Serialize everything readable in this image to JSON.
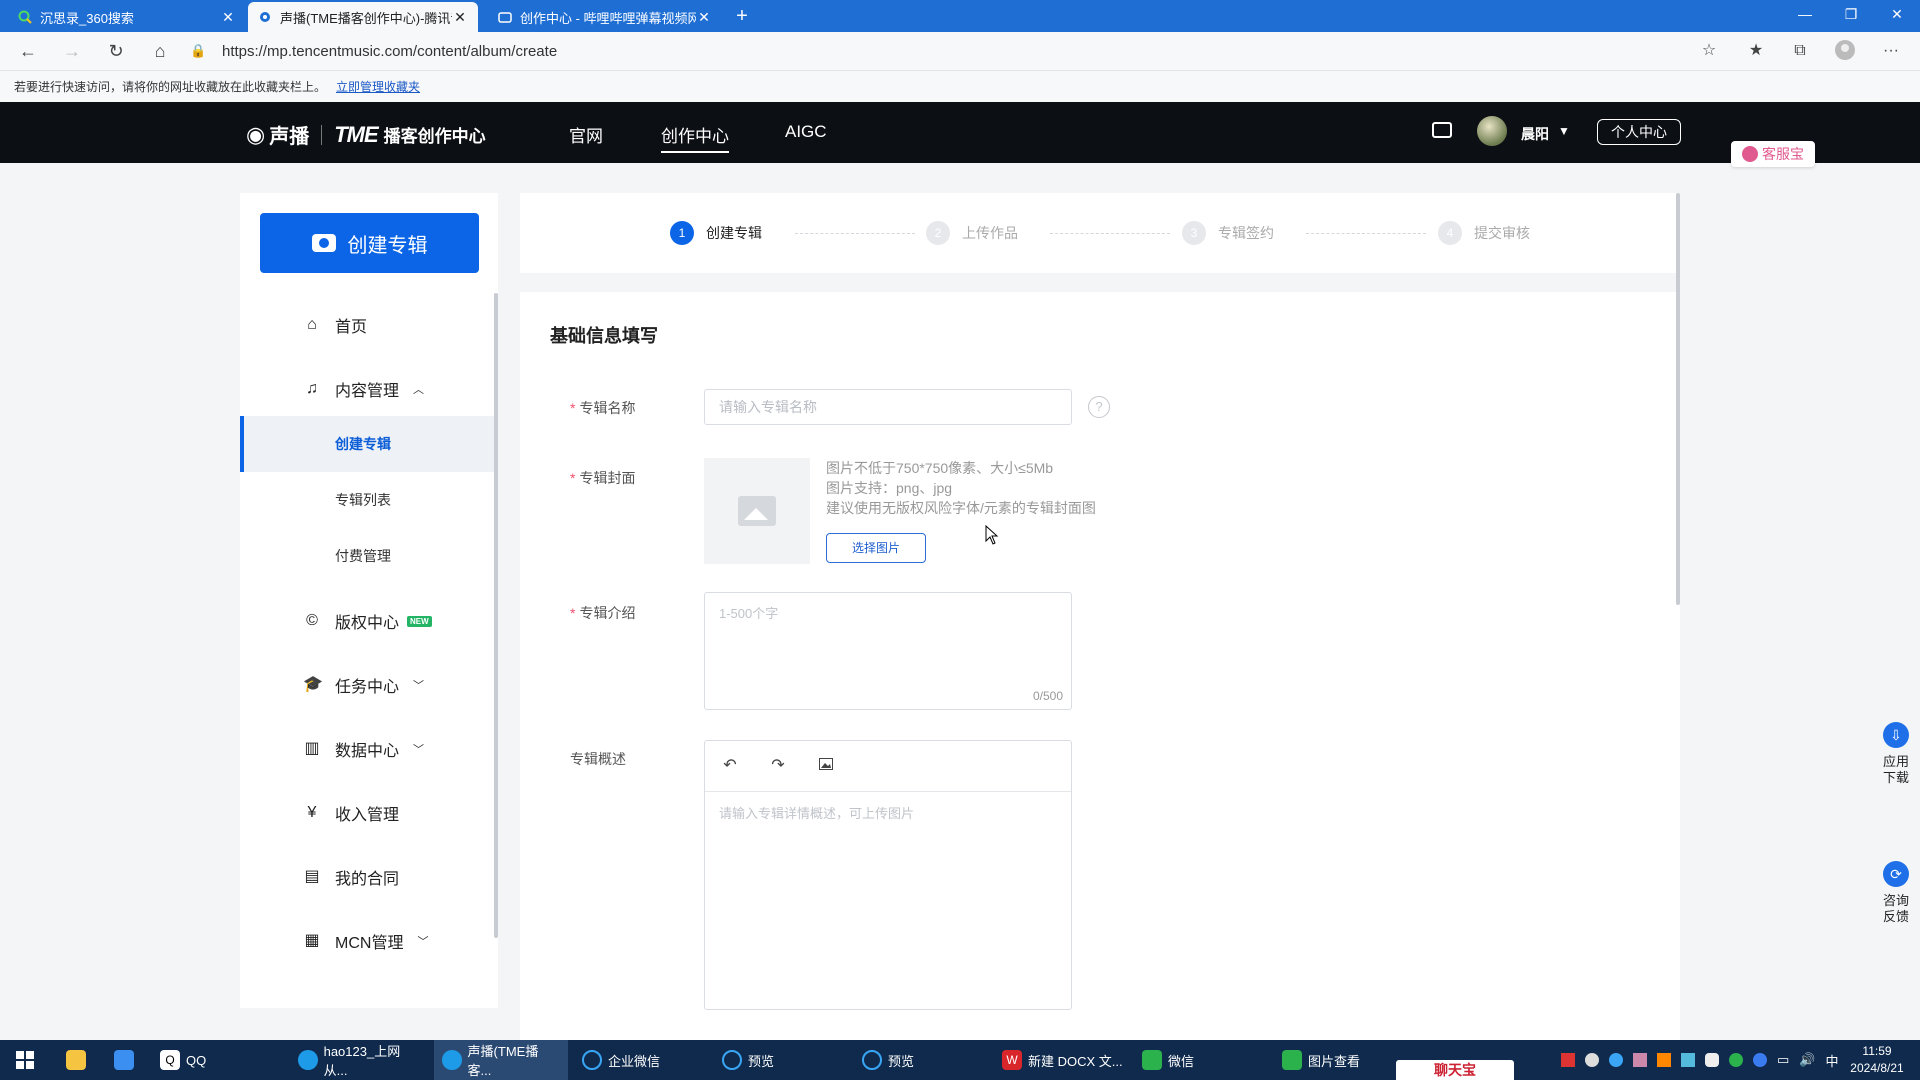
{
  "browser": {
    "tabs": [
      {
        "title": "沉思录_360搜索",
        "icon": "search-icon"
      },
      {
        "title": "声播(TME播客创作中心)-腾讯音",
        "icon": "site-icon"
      },
      {
        "title": "创作中心 - 哔哩哔哩弹幕视频网",
        "icon": "bilibili-icon"
      }
    ],
    "url": "https://mp.tencentmusic.com/content/album/create",
    "favbar_message": "若要进行快速访问，请将你的网址收藏放在此收藏夹栏上。",
    "favbar_link": "立即管理收藏夹"
  },
  "header": {
    "logo_name": "声播",
    "logo_brand": "TME",
    "logo_sub": "播客创作中心",
    "nav": [
      "官网",
      "创作中心",
      "AIGC"
    ],
    "active_nav": "创作中心",
    "user_name": "晨阳",
    "center_button": "个人中心",
    "kefu": "客服宝"
  },
  "sidebar": {
    "create_button": "创建专辑",
    "items": [
      {
        "label": "首页",
        "icon": "home-icon"
      },
      {
        "label": "内容管理",
        "icon": "music-folder-icon",
        "expanded": true
      },
      {
        "label": "版权中心",
        "icon": "copyright-icon",
        "badge": "NEW"
      },
      {
        "label": "任务中心",
        "icon": "graduation-cap-icon"
      },
      {
        "label": "数据中心",
        "icon": "bar-chart-icon"
      },
      {
        "label": "收入管理",
        "icon": "yen-icon"
      },
      {
        "label": "我的合同",
        "icon": "document-icon"
      },
      {
        "label": "MCN管理",
        "icon": "grid-icon"
      }
    ],
    "sub_items": [
      "创建专辑",
      "专辑列表",
      "付费管理"
    ],
    "active_sub": "创建专辑"
  },
  "steps": [
    {
      "num": "1",
      "label": "创建专辑",
      "active": true
    },
    {
      "num": "2",
      "label": "上传作品",
      "active": false
    },
    {
      "num": "3",
      "label": "专辑签约",
      "active": false
    },
    {
      "num": "4",
      "label": "提交审核",
      "active": false
    }
  ],
  "form": {
    "section_title": "基础信息填写",
    "name_label": "专辑名称",
    "name_placeholder": "请输入专辑名称",
    "cover_label": "专辑封面",
    "cover_hints": [
      "图片不低于750*750像素、大小≤5Mb",
      "图片支持：png、jpg",
      "建议使用无版权风险字体/元素的专辑封面图"
    ],
    "choose_button": "选择图片",
    "intro_label": "专辑介绍",
    "intro_placeholder": "1-500个字",
    "intro_counter": "0/500",
    "overview_label": "专辑概述",
    "overview_placeholder": "请输入专辑详情概述，可上传图片"
  },
  "float_buttons": [
    {
      "label": "应用下载",
      "icon": "cloud-download-icon"
    },
    {
      "label": "咨询反馈",
      "icon": "feedback-icon"
    }
  ],
  "taskbar": {
    "items": [
      {
        "label": "QQ",
        "icon": "qq-icon"
      },
      {
        "label": "hao123_上网从...",
        "icon": "edge-icon"
      },
      {
        "label": "声播(TME播客...",
        "icon": "edge-icon",
        "active": true
      },
      {
        "label": "企业微信",
        "icon": "search-icon"
      },
      {
        "label": "预览",
        "icon": "search-icon"
      },
      {
        "label": "预览",
        "icon": "search-icon"
      },
      {
        "label": "新建 DOCX 文...",
        "icon": "wps-icon"
      },
      {
        "label": "微信",
        "icon": "wechat-icon"
      },
      {
        "label": "图片查看",
        "icon": "wechat-icon"
      }
    ],
    "time": "11:59",
    "date": "2024/8/21",
    "ime": "中",
    "notice": "聊天宝"
  },
  "colors": {
    "accent": "#0b65e6",
    "header_bg": "#0c0f14",
    "tab_bg": "#1f6ed4",
    "taskbar_bg": "#0f2a4d",
    "required": "#f0506e"
  }
}
